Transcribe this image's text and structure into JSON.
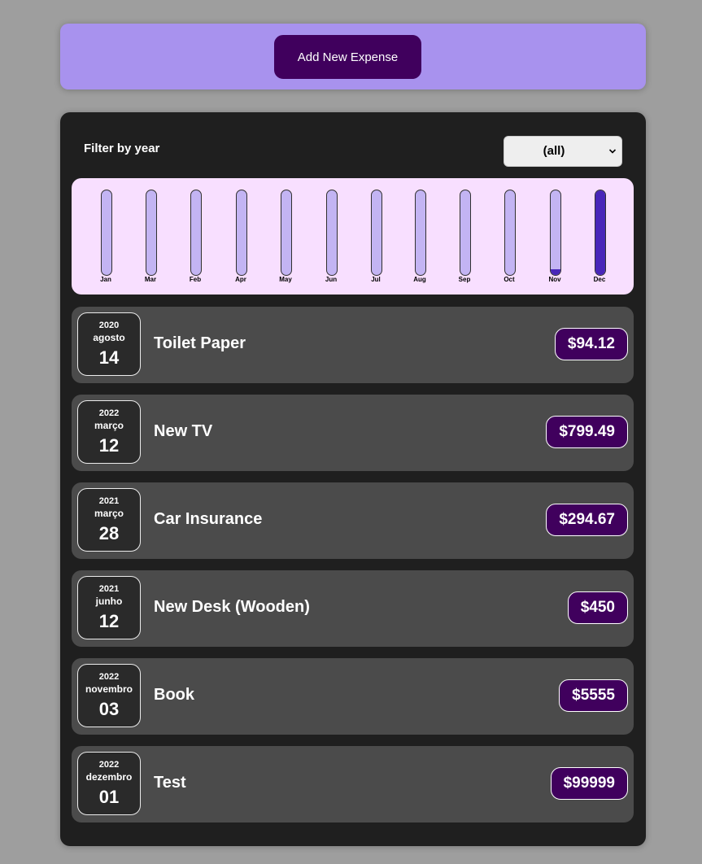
{
  "new_expense": {
    "button_label": "Add New Expense"
  },
  "filter": {
    "label": "Filter by year",
    "selected": "(all)"
  },
  "chart_data": {
    "type": "bar",
    "categories": [
      "Jan",
      "Mar",
      "Feb",
      "Apr",
      "May",
      "Jun",
      "Jul",
      "Aug",
      "Sep",
      "Oct",
      "Nov",
      "Dec"
    ],
    "values": [
      0,
      0,
      0,
      0,
      0,
      0,
      0,
      0,
      0,
      0,
      0.07,
      1.0
    ],
    "ylim": [
      0,
      1
    ],
    "fill_color": "#4826b9",
    "empty_color": "#c3b4f3"
  },
  "expenses": [
    {
      "year": "2020",
      "month": "agosto",
      "day": "14",
      "title": "Toilet Paper",
      "amount": "$94.12"
    },
    {
      "year": "2022",
      "month": "março",
      "day": "12",
      "title": "New TV",
      "amount": "$799.49"
    },
    {
      "year": "2021",
      "month": "março",
      "day": "28",
      "title": "Car Insurance",
      "amount": "$294.67"
    },
    {
      "year": "2021",
      "month": "junho",
      "day": "12",
      "title": "New Desk (Wooden)",
      "amount": "$450"
    },
    {
      "year": "2022",
      "month": "novembro",
      "day": "03",
      "title": "Book",
      "amount": "$5555"
    },
    {
      "year": "2022",
      "month": "dezembro",
      "day": "01",
      "title": "Test",
      "amount": "$99999"
    }
  ]
}
